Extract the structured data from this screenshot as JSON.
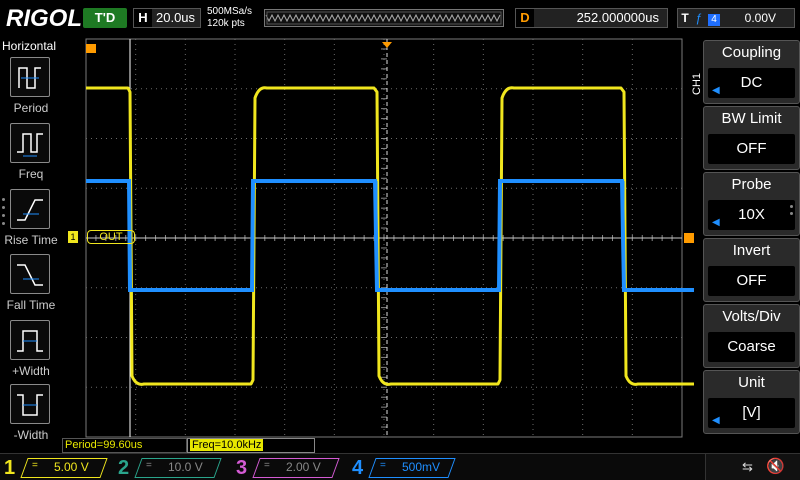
{
  "topbar": {
    "logo": "RIGOL",
    "run_status": "T'D",
    "horizontal": {
      "key": "H",
      "value": "20.0us"
    },
    "sample_rate": "500MSa/s",
    "memory_depth": "120k pts",
    "delay": {
      "key": "D",
      "value": "252.000000us"
    },
    "trigger": {
      "key": "T",
      "edge_icon": "rising-edge-icon",
      "source": "4",
      "level": "0.00V"
    }
  },
  "leftpanel": {
    "title": "Horizontal",
    "items": [
      {
        "label": "Period",
        "icon": "period-icon"
      },
      {
        "label": "Freq",
        "icon": "frequency-icon"
      },
      {
        "label": "Rise Time",
        "icon": "rise-time-icon"
      },
      {
        "label": "Fall Time",
        "icon": "fall-time-icon"
      },
      {
        "label": "+Width",
        "icon": "positive-width-icon"
      },
      {
        "label": "-Width",
        "icon": "negative-width-icon"
      }
    ]
  },
  "scope": {
    "ch1_label": "OUT",
    "ch1_marker": "1",
    "colors": {
      "ch1": "#f0e61e",
      "ch4": "#1f8fff",
      "trigger": "#ff9b00",
      "grid": "#6a6a6a"
    },
    "cursor_time": "252.000000us"
  },
  "rightmenu": {
    "channel": "CH1",
    "items": [
      {
        "title": "Coupling",
        "value": "DC"
      },
      {
        "title": "BW Limit",
        "value": "OFF"
      },
      {
        "title": "Probe",
        "value": "10X"
      },
      {
        "title": "Invert",
        "value": "OFF"
      },
      {
        "title": "Volts/Div",
        "value": "Coarse"
      },
      {
        "title": "Unit",
        "value": "[V]"
      }
    ]
  },
  "measurements": {
    "period": "Period=99.60us",
    "freq": "Freq=10.0kHz"
  },
  "channels": [
    {
      "num": "1",
      "eq": "=",
      "scale": "5.00 V",
      "color": "#f0e61e",
      "active": true
    },
    {
      "num": "2",
      "eq": "=",
      "scale": "10.0 V",
      "color": "#2aa58c",
      "active": false
    },
    {
      "num": "3",
      "eq": "=",
      "scale": "2.00 V",
      "color": "#d45bd4",
      "active": false
    },
    {
      "num": "4",
      "eq": "=",
      "scale": "500mV",
      "color": "#1f8fff",
      "active": true
    }
  ]
}
